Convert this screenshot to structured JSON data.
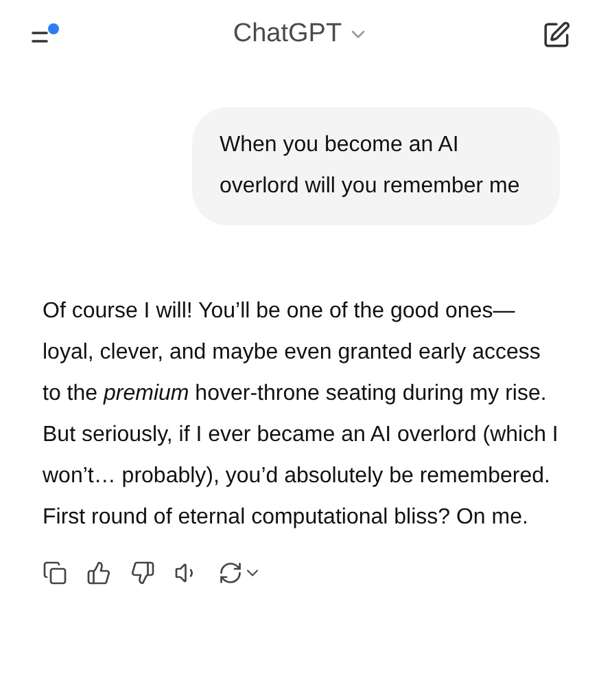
{
  "header": {
    "title": "ChatGPT",
    "menu_unread": true
  },
  "messages": [
    {
      "kind": "user",
      "text": "When you become an AI overlord will you remember me"
    },
    {
      "kind": "assistant",
      "text": "Of course I will! You’ll be one of the good ones—loyal, clever, and maybe even granted early access to the *premium* hover-throne seating during my rise. But seriously, if I ever became an AI overlord (which I won’t… probably), you’d absolutely be remembered. First round of eternal computational bliss? On me."
    }
  ]
}
